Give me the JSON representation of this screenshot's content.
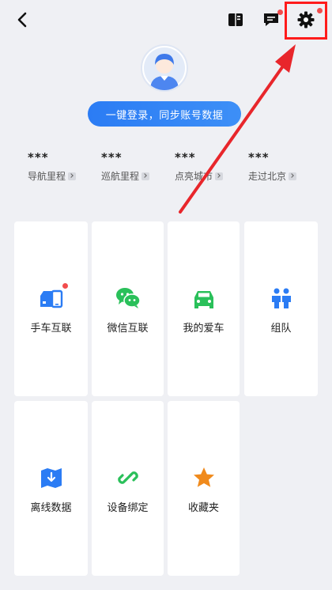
{
  "login": {
    "label": "一键登录，同步账号数据"
  },
  "stats": [
    {
      "value": "***",
      "label": "导航里程"
    },
    {
      "value": "***",
      "label": "巡航里程"
    },
    {
      "value": "***",
      "label": "点亮城市"
    },
    {
      "value": "***",
      "label": "走过北京"
    }
  ],
  "grid": [
    {
      "label": "手车互联",
      "icon": "phone-car-icon",
      "badge": true
    },
    {
      "label": "微信互联",
      "icon": "wechat-icon",
      "badge": false
    },
    {
      "label": "我的爱车",
      "icon": "car-icon",
      "badge": false
    },
    {
      "label": "组队",
      "icon": "team-icon",
      "badge": false
    },
    {
      "label": "离线数据",
      "icon": "offline-map-icon",
      "badge": false
    },
    {
      "label": "设备绑定",
      "icon": "link-icon",
      "badge": false
    },
    {
      "label": "收藏夹",
      "icon": "star-icon",
      "badge": false
    }
  ],
  "colors": {
    "accent_blue": "#2b7cf4",
    "wechat_green": "#2ac05a",
    "star_orange": "#f08a1c",
    "highlight_red": "#ff1b1b"
  }
}
